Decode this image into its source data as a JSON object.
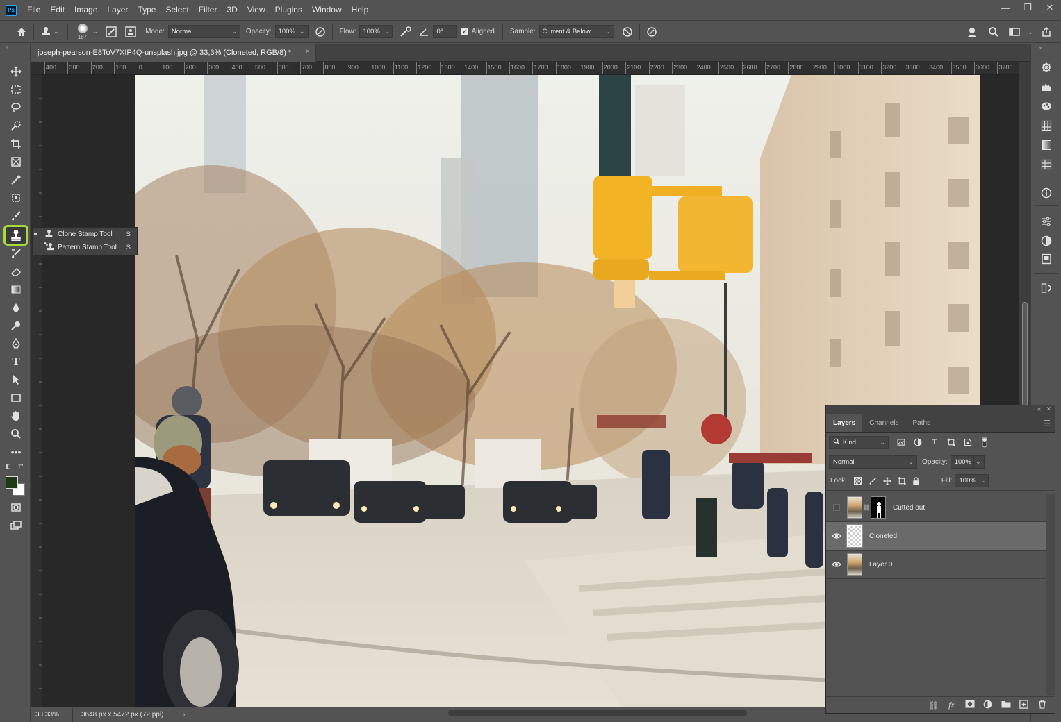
{
  "app": {
    "logo": "Ps"
  },
  "menu": [
    "File",
    "Edit",
    "Image",
    "Layer",
    "Type",
    "Select",
    "Filter",
    "3D",
    "View",
    "Plugins",
    "Window",
    "Help"
  ],
  "window_controls": {
    "minimize": "—",
    "restore": "❐",
    "close": "✕"
  },
  "options_bar": {
    "brush_size": "187",
    "mode_label": "Mode:",
    "mode_value": "Normal",
    "opacity_label": "Opacity:",
    "opacity_value": "100%",
    "flow_label": "Flow:",
    "flow_value": "100%",
    "angle_value": "0°",
    "aligned_label": "Aligned",
    "aligned_checked": true,
    "sample_label": "Sample:",
    "sample_value": "Current & Below"
  },
  "document": {
    "tab_title": "joseph-pearson-E8ToV7XIP4Q-unsplash.jpg @ 33,3% (Cloneted, RGB/8) *",
    "close": "×"
  },
  "ruler_top": [
    "400",
    "300",
    "200",
    "100",
    "0",
    "100",
    "200",
    "300",
    "400",
    "500",
    "600",
    "700",
    "800",
    "900",
    "1000",
    "1100",
    "1200",
    "1300",
    "1400",
    "1500",
    "1600",
    "1700",
    "1800",
    "1900",
    "2000",
    "2100",
    "2200",
    "2300",
    "2400",
    "2500",
    "2600",
    "2700",
    "2800",
    "2900",
    "3000",
    "3100",
    "3200",
    "3300",
    "3400",
    "3500",
    "3600",
    "3700"
  ],
  "flyout": {
    "items": [
      {
        "label": "Clone Stamp Tool",
        "key": "S",
        "active": true
      },
      {
        "label": "Pattern Stamp Tool",
        "key": "S",
        "active": false
      }
    ]
  },
  "status": {
    "zoom": "33,33%",
    "doc_info": "3648 px x 5472 px (72 ppi)",
    "arrow": "›"
  },
  "layers_panel": {
    "tabs": [
      "Layers",
      "Channels",
      "Paths"
    ],
    "active_tab": "Layers",
    "filter_kind": "Kind",
    "blend_mode": "Normal",
    "opacity_label": "Opacity:",
    "opacity_value": "100%",
    "lock_label": "Lock:",
    "fill_label": "Fill:",
    "fill_value": "100%",
    "layers": [
      {
        "name": "Cutted out",
        "visible": false,
        "has_mask": true,
        "selected": false
      },
      {
        "name": "Cloneted",
        "visible": true,
        "has_mask": false,
        "selected": true
      },
      {
        "name": "Layer 0",
        "visible": true,
        "has_mask": false,
        "selected": false
      }
    ]
  },
  "colors": {
    "highlight": "#a6d93a",
    "foreground": "#1d3a12",
    "background": "#ffffff"
  }
}
